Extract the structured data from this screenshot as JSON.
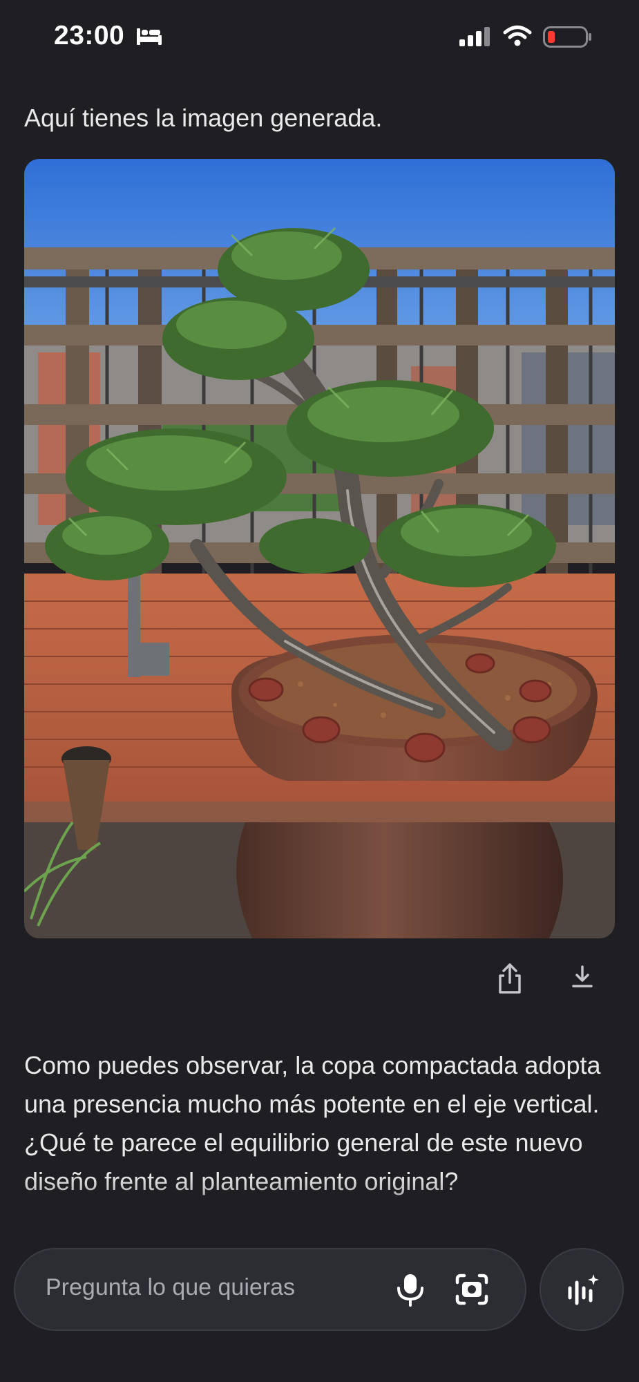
{
  "status_bar": {
    "time": "23:00",
    "icons": [
      "bed-icon",
      "signal-icon",
      "wifi-icon",
      "battery-icon"
    ],
    "battery_color": "#ff3b30"
  },
  "chat": {
    "intro": "Aquí tienes la imagen generada.",
    "image_description_icon": "generated-bonsai-image",
    "actions": {
      "share_icon": "share-icon",
      "download_icon": "download-icon"
    },
    "response": "Como puedes observar, la copa compactada adopta una presencia mucho más potente en el eje vertical. ¿Qué te parece el equilibrio general de este nuevo diseño frente al planteamiento original?"
  },
  "input": {
    "placeholder": "Pregunta lo que quieras",
    "mic_icon": "mic-icon",
    "camera_icon": "camera-icon",
    "live_icon": "live-waveform-icon"
  },
  "colors": {
    "background": "#1f1f23",
    "text": "#e9e9ec",
    "input_bg": "#2b2d33",
    "placeholder": "#a9abb1"
  }
}
